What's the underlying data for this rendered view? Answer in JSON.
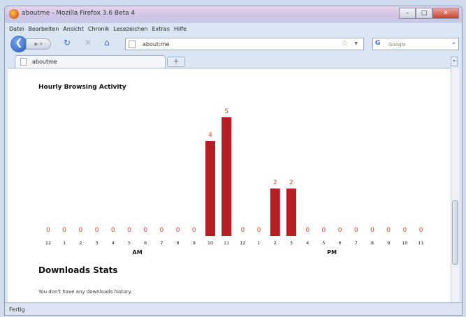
{
  "window": {
    "title": "aboutme - Mozilla Firefox 3.6 Beta 4"
  },
  "menu": {
    "items": [
      "Datei",
      "Bearbeiten",
      "Ansicht",
      "Chronik",
      "Lesezeichen",
      "Extras",
      "Hilfe"
    ]
  },
  "navbar": {
    "url": "about:me",
    "search_placeholder": "Google"
  },
  "tabs": [
    {
      "label": "aboutme"
    }
  ],
  "page": {
    "activity_title": "Hourly Browsing Activity",
    "downloads_title": "Downloads Stats",
    "downloads_message": "You don't have any downloads history."
  },
  "status": {
    "text": "Fertig"
  },
  "colors": {
    "bar": "#b51f24",
    "value_label": "#d94a2a",
    "accent": "#1f55b8"
  },
  "icons": {
    "app": "firefox-icon",
    "back": "back-arrow-icon",
    "forward": "forward-arrow-icon",
    "reload": "reload-icon",
    "stop": "stop-icon",
    "home": "home-icon",
    "bookmark": "star-icon",
    "search": "magnifier-icon",
    "page": "page-icon",
    "newtab": "plus-icon"
  },
  "chart_data": {
    "type": "bar",
    "title": "Hourly Browsing Activity",
    "categories": [
      "12",
      "1",
      "2",
      "3",
      "4",
      "5",
      "6",
      "7",
      "8",
      "9",
      "10",
      "11",
      "12",
      "1",
      "2",
      "3",
      "4",
      "5",
      "6",
      "7",
      "8",
      "9",
      "10",
      "11"
    ],
    "values": [
      0,
      0,
      0,
      0,
      0,
      0,
      0,
      0,
      0,
      0,
      4,
      5,
      0,
      0,
      2,
      2,
      0,
      0,
      0,
      0,
      0,
      0,
      0,
      0
    ],
    "period_labels": [
      "AM",
      "PM"
    ],
    "ylim": [
      0,
      5
    ],
    "grid": false,
    "legend": "none"
  }
}
